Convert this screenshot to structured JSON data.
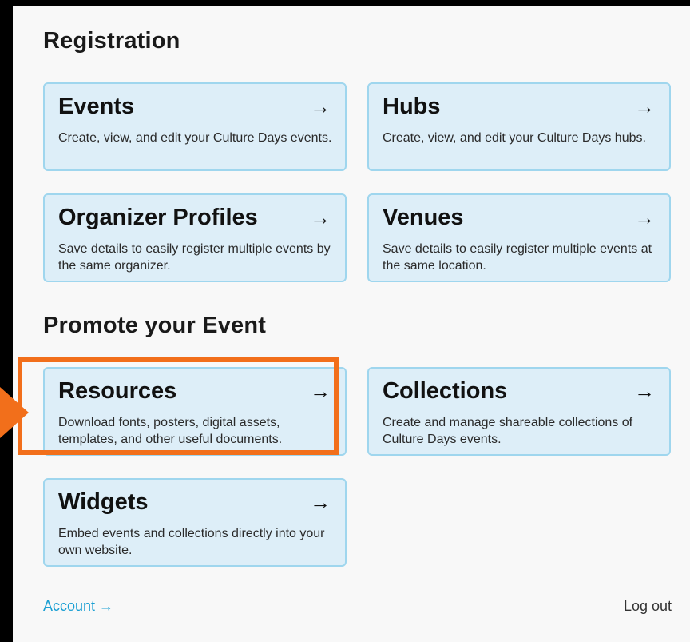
{
  "sections": {
    "registration": {
      "title": "Registration"
    },
    "promote": {
      "title": "Promote your Event"
    }
  },
  "cards": {
    "events": {
      "title": "Events",
      "description": "Create, view, and edit your Culture Days events.",
      "arrow": "→"
    },
    "hubs": {
      "title": "Hubs",
      "description": "Create, view, and edit your Culture Days hubs.",
      "arrow": "→"
    },
    "organizer_profiles": {
      "title": "Organizer Profiles",
      "description": "Save details to easily register multiple events by the same organizer.",
      "arrow": "→"
    },
    "venues": {
      "title": "Venues",
      "description": "Save details to easily register multiple events at the same location.",
      "arrow": "→"
    },
    "resources": {
      "title": "Resources",
      "description": "Download fonts, posters, digital assets, templates, and other useful documents.",
      "arrow": "→"
    },
    "collections": {
      "title": "Collections",
      "description": "Create and manage shareable collections of Culture Days events.",
      "arrow": "→"
    },
    "widgets": {
      "title": "Widgets",
      "description": "Embed events and collections directly into your own website.",
      "arrow": "→"
    }
  },
  "footer": {
    "account_label": "Account →",
    "logout_label": "Log out"
  },
  "colors": {
    "card_background": "#ddeef8",
    "card_border": "#9fd6ee",
    "highlight": "#f26f1b",
    "link": "#1a9fd3"
  }
}
